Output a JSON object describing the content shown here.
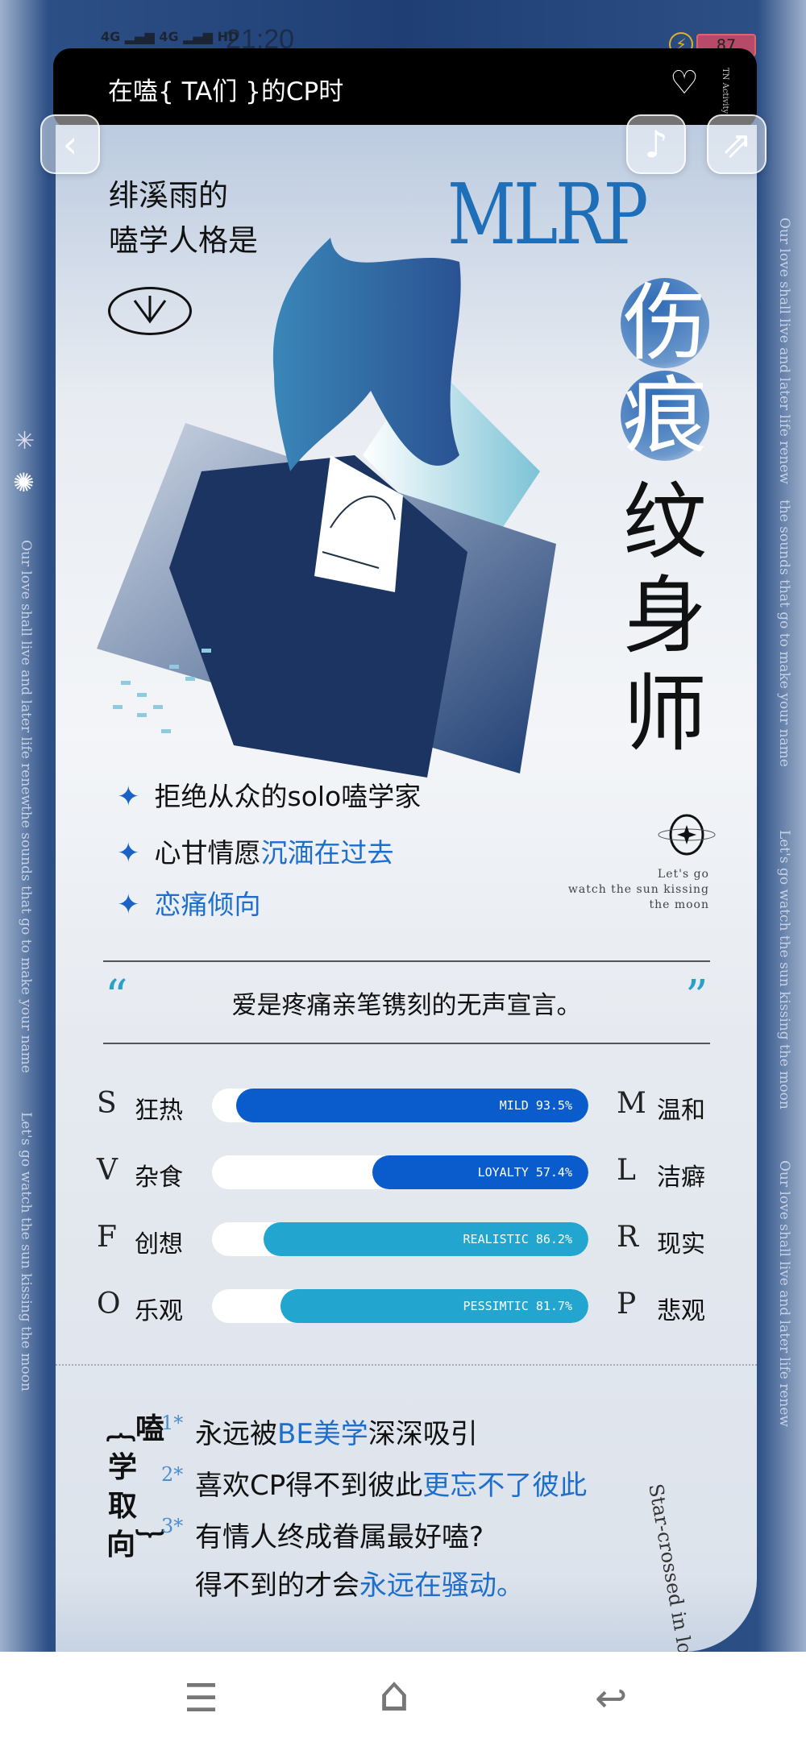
{
  "status_bar": {
    "signal1": "4G",
    "signal2": "4G",
    "hd": "HD",
    "time": "21:20",
    "battery": "87"
  },
  "header": {
    "title": "在嗑{ TA们 }的CP时",
    "side_text": "TN Activity"
  },
  "buttons": {
    "back": "‹",
    "music": "♪",
    "share": "⇗"
  },
  "intro": {
    "line1": "绯溪雨的",
    "line2": "嗑学人格是"
  },
  "type_code": "MLRP",
  "type_name": [
    "伤",
    "痕",
    "纹",
    "身",
    "师"
  ],
  "traits": [
    {
      "text": "拒绝从众的solo嗑学家",
      "highlight": ""
    },
    {
      "text": "心甘情愿",
      "highlight": "沉湎在过去"
    },
    {
      "text": "",
      "highlight": "恋痛倾向"
    }
  ],
  "motto": {
    "line1": "Let's go",
    "line2": "watch the sun kissing",
    "line3": "the moon"
  },
  "quote": {
    "open": "“",
    "text": "爱是疼痛亲笔镌刻的无声宣言。",
    "close": "”"
  },
  "dimensions": [
    {
      "left_letter": "S",
      "left_label": "狂热",
      "right_letter": "M",
      "right_label": "温和",
      "result": "MILD",
      "percent": 93.5,
      "percent_label": "93.5%",
      "color": "#0a5ccc"
    },
    {
      "left_letter": "V",
      "left_label": "杂食",
      "right_letter": "L",
      "right_label": "洁癖",
      "result": "LOYALTY",
      "percent": 57.4,
      "percent_label": "57.4%",
      "color": "#0a5ccc"
    },
    {
      "left_letter": "F",
      "left_label": "创想",
      "right_letter": "R",
      "right_label": "现实",
      "result": "REALISTIC",
      "percent": 86.2,
      "percent_label": "86.2%",
      "color": "#22a5cf"
    },
    {
      "left_letter": "O",
      "left_label": "乐观",
      "right_letter": "P",
      "right_label": "悲观",
      "result": "PESSIMTIC",
      "percent": 81.7,
      "percent_label": "81.7%",
      "color": "#22a5cf"
    }
  ],
  "orientation": {
    "label": "︷嗑学取向︸",
    "items": [
      {
        "num": "1*",
        "a": "永远被",
        "b": "BE美学",
        "c": "深深吸引"
      },
      {
        "num": "2*",
        "a": "喜欢CP得不到彼此",
        "b": "更忘不了彼此",
        "c": ""
      },
      {
        "num": "3*",
        "a": "有情人终成眷属最好嗑?",
        "b": "",
        "c": ""
      }
    ],
    "item3_line2": {
      "a": "得不到的才会",
      "b": "永远在骚动。"
    }
  },
  "curved_text": "Star-crossed in love",
  "side_texts": {
    "left1": "Our love shall live and later life renew",
    "left2": "the sounds that go to make your name",
    "left3": "Let's go watch the sun kissing the moon",
    "right1": "Our love shall live and later life renew",
    "right2": "the sounds that go to make your name",
    "right3": "Let's go watch the sun kissing the moon",
    "right4": "Our love shall live and later life renew",
    "sep": "/"
  },
  "nav": {
    "menu": "☰",
    "home": "⌂",
    "back": "↩"
  }
}
